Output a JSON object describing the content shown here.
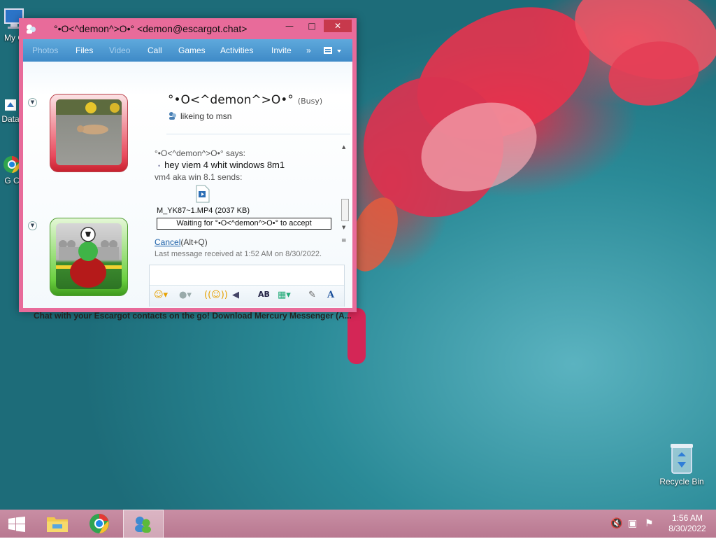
{
  "desktop": {
    "icons": [
      {
        "label": "My C"
      },
      {
        "label": "Data"
      },
      {
        "label": "G C"
      },
      {
        "label": "Recycle Bin"
      }
    ]
  },
  "window": {
    "title": "°•О<^demon^>О•° <demon@escargot.chat>",
    "controls": {
      "minimize": "▭",
      "maximize": "□",
      "close": "✕"
    },
    "toolbar": [
      "Photos",
      "Files",
      "Video",
      "Call",
      "Games",
      "Activities",
      "Invite",
      "»"
    ],
    "contact": {
      "name": "°•О<^demon^>О•°",
      "status": "(Busy)",
      "personal_message": "likeing to msn"
    },
    "conversation": {
      "sender_says": "°•О<^demon^>О•° says:",
      "message": "hey viem 4 whit windows 8m1",
      "sender_sends": "vm4 aka win 8.1 sends:",
      "file_name": "M_YK87~1.MP4 (2037 KB)",
      "waiting": "Waiting for °•О<^demon^>О•° to accept",
      "cancel_link": "Cancel",
      "cancel_shortcut": "(Alt+Q)",
      "last_received": "Last message received at 1:52 AM on 8/30/2022."
    },
    "ad_text": "Chat with your Escargot contacts on the go! Download Mercury Messenger (A..."
  },
  "taskbar": {
    "time": "1:56 AM",
    "date": "8/30/2022"
  }
}
